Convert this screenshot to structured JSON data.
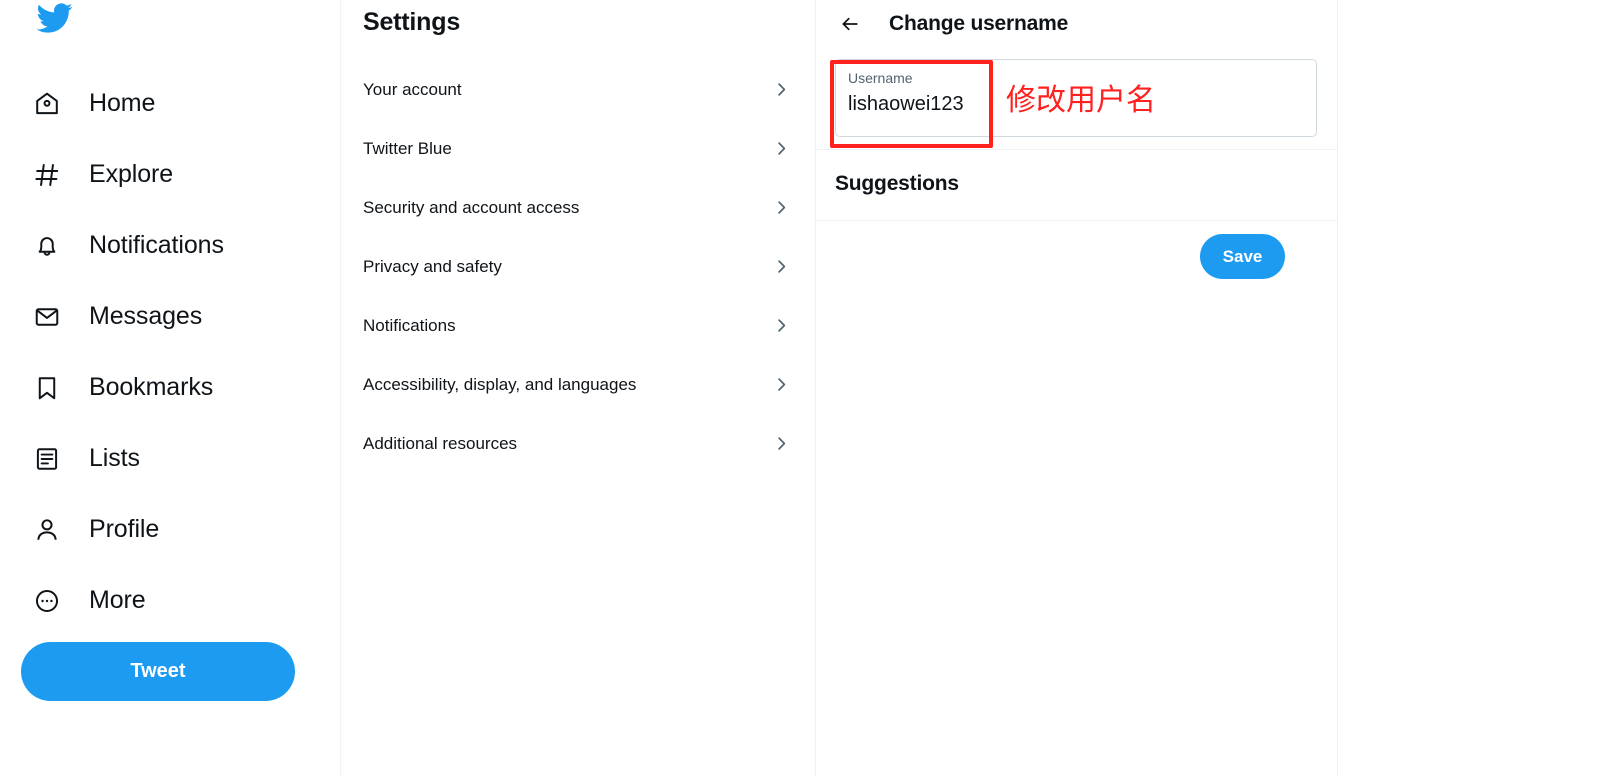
{
  "brand": {
    "logo_icon": "twitter-bird-icon",
    "accent_color": "#1d9bf0",
    "annotation_color": "#ff2020",
    "text_color": "#0f1419",
    "muted_color": "#536471",
    "border_color": "#eff3f4"
  },
  "sidebar": {
    "items": [
      {
        "label": "Home",
        "icon": "home-icon"
      },
      {
        "label": "Explore",
        "icon": "hashtag-icon"
      },
      {
        "label": "Notifications",
        "icon": "bell-icon"
      },
      {
        "label": "Messages",
        "icon": "envelope-icon"
      },
      {
        "label": "Bookmarks",
        "icon": "bookmark-icon"
      },
      {
        "label": "Lists",
        "icon": "list-icon"
      },
      {
        "label": "Profile",
        "icon": "person-icon"
      },
      {
        "label": "More",
        "icon": "more-circle-icon"
      }
    ],
    "tweet_button": "Tweet"
  },
  "settings": {
    "title": "Settings",
    "items": [
      {
        "label": "Your account",
        "chevron": "chevron-right-icon"
      },
      {
        "label": "Twitter Blue",
        "chevron": "chevron-right-icon"
      },
      {
        "label": "Security and account access",
        "chevron": "chevron-right-icon"
      },
      {
        "label": "Privacy and safety",
        "chevron": "chevron-right-icon"
      },
      {
        "label": "Notifications",
        "chevron": "chevron-right-icon"
      },
      {
        "label": "Accessibility, display, and languages",
        "chevron": "chevron-right-icon"
      },
      {
        "label": "Additional resources",
        "chevron": "chevron-right-icon"
      }
    ]
  },
  "main": {
    "back_icon": "back-arrow-icon",
    "title": "Change username",
    "username_field": {
      "label": "Username",
      "value": "lishaowei123"
    },
    "suggestions_title": "Suggestions",
    "save_label": "Save"
  },
  "annotation": {
    "text": "修改用户名"
  }
}
